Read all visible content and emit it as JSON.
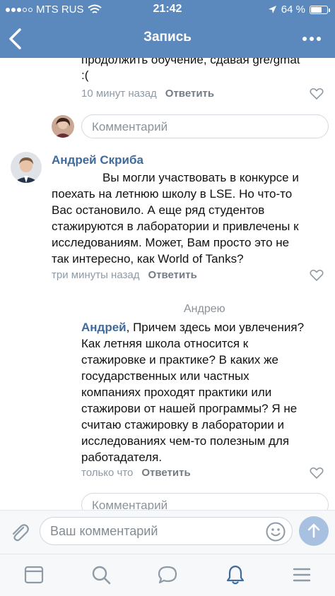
{
  "status_bar": {
    "carrier": "MTS RUS",
    "time": "21:42",
    "battery": "64 %"
  },
  "nav": {
    "title": "Запись"
  },
  "prev_comment": {
    "text_line1": "продолжить обучение, сдавая gre/gmat",
    "text_line2": ":(",
    "time": "10 минут назад",
    "reply_label": "Ответить"
  },
  "comment_input_1": {
    "placeholder": "Комментарий"
  },
  "comment_andrey": {
    "author": "Андрей Скриба",
    "text_lines": [
      "Вы могли участвовать в конкурсе и",
      "поехать на летнюю школу в LSE. Но что-то",
      "Вас остановило. А еще ряд студентов",
      "стажируются в лаборатории и привлечены к",
      "исследованиям. Может, Вам просто это не",
      "так интересно, как World of Tanks?"
    ],
    "time": "три минуты назад",
    "reply_label": "Ответить"
  },
  "reply_comment": {
    "reply_to": "Андрею",
    "mention": "Андрей",
    "first_line_rest": ", Причем здесь мои увлечения?",
    "text_lines": [
      "Как летняя школа относится к",
      "стажировке и практике? В каких же",
      "государственных или частных",
      "компаниях проходят практики или",
      "стажирови от нашей программы? Я не",
      "считаю стажировку в лаборатории и",
      "исследованиях чем-то полезным для",
      "работадателя."
    ],
    "time": "только что",
    "reply_label": "Ответить"
  },
  "comment_input_2": {
    "placeholder": "Комментарий"
  },
  "composer": {
    "placeholder": "Ваш комментарий"
  },
  "colors": {
    "header_bg": "#5b88bd",
    "link": "#3f6a9c",
    "send_button": "#a9c1e1",
    "active_tab": "#3f6a9c"
  },
  "tabbar": {
    "items": [
      "news-icon",
      "search-icon",
      "messages-icon",
      "notifications-icon",
      "menu-icon"
    ],
    "active": "notifications-icon"
  }
}
